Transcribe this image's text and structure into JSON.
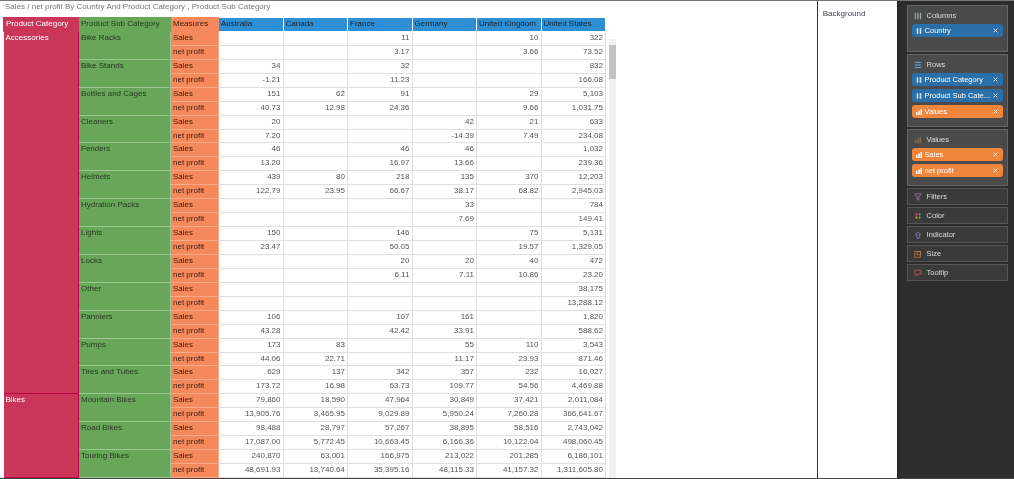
{
  "title": "Sales / net profit By Country And Product Category , Product Sub Category",
  "table": {
    "columns": [
      "Product Category",
      "Product Sub Category",
      "Measures",
      "Australia",
      "Canada",
      "France",
      "Germany",
      "United Kingdom",
      "United States"
    ],
    "groups": [
      {
        "category": "Accessories",
        "subcategories": [
          {
            "name": "Bike Racks",
            "rows": [
              {
                "measure": "Sales",
                "values": [
                  {
                    "empty": true
                  },
                  {
                    "empty": true
                  },
                  {
                    "value": "11"
                  },
                  {
                    "empty": true
                  },
                  {
                    "value": "10"
                  },
                  {
                    "value": "322"
                  }
                ]
              },
              {
                "measure": "net profit",
                "values": [
                  {
                    "empty": true
                  },
                  {
                    "empty": true
                  },
                  {
                    "value": "3.17"
                  },
                  {
                    "empty": true
                  },
                  {
                    "value": "3.66"
                  },
                  {
                    "value": "73.52"
                  }
                ]
              }
            ]
          },
          {
            "name": "Bike Stands",
            "rows": [
              {
                "measure": "Sales",
                "values": [
                  {
                    "value": "34"
                  },
                  {
                    "empty": true
                  },
                  {
                    "value": "32"
                  },
                  {
                    "empty": true
                  },
                  {
                    "empty": true
                  },
                  {
                    "value": "832"
                  }
                ]
              },
              {
                "measure": "net profit",
                "values": [
                  {
                    "value": "-1.21"
                  },
                  {
                    "empty": true
                  },
                  {
                    "value": "11.23"
                  },
                  {
                    "empty": true
                  },
                  {
                    "empty": true
                  },
                  {
                    "value": "166.08"
                  }
                ]
              }
            ]
          },
          {
            "name": "Bottles and Cages",
            "rows": [
              {
                "measure": "Sales",
                "values": [
                  {
                    "value": "151"
                  },
                  {
                    "value": "62"
                  },
                  {
                    "value": "91"
                  },
                  {
                    "empty": true
                  },
                  {
                    "value": "29"
                  },
                  {
                    "value": "5,103"
                  }
                ]
              },
              {
                "measure": "net profit",
                "values": [
                  {
                    "value": "40.73"
                  },
                  {
                    "value": "12.98"
                  },
                  {
                    "value": "24.36"
                  },
                  {
                    "empty": true
                  },
                  {
                    "value": "9.66"
                  },
                  {
                    "value": "1,031.75"
                  }
                ]
              }
            ]
          },
          {
            "name": "Cleaners",
            "rows": [
              {
                "measure": "Sales",
                "values": [
                  {
                    "value": "20"
                  },
                  {
                    "empty": true
                  },
                  {
                    "empty": true
                  },
                  {
                    "value": "42"
                  },
                  {
                    "value": "21"
                  },
                  {
                    "value": "633"
                  }
                ]
              },
              {
                "measure": "net profit",
                "values": [
                  {
                    "value": "7.20"
                  },
                  {
                    "empty": true
                  },
                  {
                    "empty": true
                  },
                  {
                    "value": "-14.39"
                  },
                  {
                    "value": "7.49"
                  },
                  {
                    "value": "234.08"
                  }
                ]
              }
            ]
          },
          {
            "name": "Fenders",
            "rows": [
              {
                "measure": "Sales",
                "values": [
                  {
                    "value": "46"
                  },
                  {
                    "empty": true
                  },
                  {
                    "value": "46"
                  },
                  {
                    "value": "46"
                  },
                  {
                    "empty": true
                  },
                  {
                    "value": "1,032"
                  }
                ]
              },
              {
                "measure": "net profit",
                "values": [
                  {
                    "value": "13.20"
                  },
                  {
                    "empty": true
                  },
                  {
                    "value": "16.97"
                  },
                  {
                    "value": "13.66"
                  },
                  {
                    "empty": true
                  },
                  {
                    "value": "239.36"
                  }
                ]
              }
            ]
          },
          {
            "name": "Helmets",
            "rows": [
              {
                "measure": "Sales",
                "values": [
                  {
                    "value": "439"
                  },
                  {
                    "value": "80"
                  },
                  {
                    "value": "218"
                  },
                  {
                    "value": "135"
                  },
                  {
                    "value": "370"
                  },
                  {
                    "value": "12,203"
                  }
                ]
              },
              {
                "measure": "net profit",
                "values": [
                  {
                    "value": "122.79"
                  },
                  {
                    "value": "23.95"
                  },
                  {
                    "value": "66.67"
                  },
                  {
                    "value": "38.17"
                  },
                  {
                    "value": "68.82"
                  },
                  {
                    "value": "2,945.03"
                  }
                ]
              }
            ]
          },
          {
            "name": "Hydration Packs",
            "rows": [
              {
                "measure": "Sales",
                "values": [
                  {
                    "empty": true
                  },
                  {
                    "empty": true
                  },
                  {
                    "empty": true
                  },
                  {
                    "value": "33"
                  },
                  {
                    "empty": true
                  },
                  {
                    "value": "784"
                  }
                ]
              },
              {
                "measure": "net profit",
                "values": [
                  {
                    "empty": true
                  },
                  {
                    "empty": true
                  },
                  {
                    "empty": true
                  },
                  {
                    "value": "7.69"
                  },
                  {
                    "empty": true
                  },
                  {
                    "value": "149.41"
                  }
                ]
              }
            ]
          },
          {
            "name": "Lights",
            "rows": [
              {
                "measure": "Sales",
                "values": [
                  {
                    "value": "150"
                  },
                  {
                    "empty": true
                  },
                  {
                    "value": "146"
                  },
                  {
                    "empty": true
                  },
                  {
                    "value": "75"
                  },
                  {
                    "value": "5,131"
                  }
                ]
              },
              {
                "measure": "net profit",
                "values": [
                  {
                    "value": "23.47"
                  },
                  {
                    "empty": true
                  },
                  {
                    "value": "50.05"
                  },
                  {
                    "empty": true
                  },
                  {
                    "value": "19.57"
                  },
                  {
                    "value": "1,329.05"
                  }
                ]
              }
            ]
          },
          {
            "name": "Locks",
            "rows": [
              {
                "measure": "Sales",
                "values": [
                  {
                    "empty": true
                  },
                  {
                    "empty": true
                  },
                  {
                    "value": "20"
                  },
                  {
                    "value": "20"
                  },
                  {
                    "value": "40"
                  },
                  {
                    "value": "472"
                  }
                ]
              },
              {
                "measure": "net profit",
                "values": [
                  {
                    "empty": true
                  },
                  {
                    "empty": true
                  },
                  {
                    "value": "6.11"
                  },
                  {
                    "value": "7.11"
                  },
                  {
                    "value": "10.86"
                  },
                  {
                    "value": "23.20"
                  }
                ]
              }
            ]
          },
          {
            "name": "Other",
            "rows": [
              {
                "measure": "Sales",
                "values": [
                  {
                    "empty": true
                  },
                  {
                    "empty": true
                  },
                  {
                    "empty": true
                  },
                  {
                    "empty": true
                  },
                  {
                    "empty": true
                  },
                  {
                    "value": "38,175"
                  }
                ]
              },
              {
                "measure": "net profit",
                "values": [
                  {
                    "empty": true
                  },
                  {
                    "empty": true
                  },
                  {
                    "empty": true
                  },
                  {
                    "empty": true
                  },
                  {
                    "empty": true
                  },
                  {
                    "value": "13,288.12"
                  }
                ]
              }
            ]
          },
          {
            "name": "Panniers",
            "rows": [
              {
                "measure": "Sales",
                "values": [
                  {
                    "value": "106"
                  },
                  {
                    "empty": true
                  },
                  {
                    "value": "107"
                  },
                  {
                    "value": "161"
                  },
                  {
                    "empty": true
                  },
                  {
                    "value": "1,820"
                  }
                ]
              },
              {
                "measure": "net profit",
                "values": [
                  {
                    "value": "43.28"
                  },
                  {
                    "empty": true
                  },
                  {
                    "value": "42.42"
                  },
                  {
                    "value": "33.91"
                  },
                  {
                    "empty": true
                  },
                  {
                    "value": "588.62"
                  }
                ]
              }
            ]
          },
          {
            "name": "Pumps",
            "rows": [
              {
                "measure": "Sales",
                "values": [
                  {
                    "value": "173"
                  },
                  {
                    "value": "83"
                  },
                  {
                    "empty": true
                  },
                  {
                    "value": "55"
                  },
                  {
                    "value": "110"
                  },
                  {
                    "value": "3,543"
                  }
                ]
              },
              {
                "measure": "net profit",
                "values": [
                  {
                    "value": "44.06"
                  },
                  {
                    "value": "22.71"
                  },
                  {
                    "empty": true
                  },
                  {
                    "value": "11.17"
                  },
                  {
                    "value": "23.93"
                  },
                  {
                    "value": "871.46"
                  }
                ]
              }
            ]
          },
          {
            "name": "Tires and Tubes",
            "rows": [
              {
                "measure": "Sales",
                "values": [
                  {
                    "value": "629"
                  },
                  {
                    "value": "137"
                  },
                  {
                    "value": "342"
                  },
                  {
                    "value": "357"
                  },
                  {
                    "value": "232"
                  },
                  {
                    "value": "16,027"
                  }
                ]
              },
              {
                "measure": "net profit",
                "values": [
                  {
                    "value": "173.72"
                  },
                  {
                    "value": "16.98"
                  },
                  {
                    "value": "63.73"
                  },
                  {
                    "value": "109.77"
                  },
                  {
                    "value": "54.56"
                  },
                  {
                    "value": "4,469.88"
                  }
                ]
              }
            ]
          }
        ]
      },
      {
        "category": "Bikes",
        "subcategories": [
          {
            "name": "Mountain Bikes",
            "rows": [
              {
                "measure": "Sales",
                "values": [
                  {
                    "value": "79,860"
                  },
                  {
                    "value": "18,590"
                  },
                  {
                    "value": "47,964"
                  },
                  {
                    "value": "30,849"
                  },
                  {
                    "value": "37,421"
                  },
                  {
                    "value": "2,011,084"
                  }
                ]
              },
              {
                "measure": "net profit",
                "values": [
                  {
                    "value": "13,905.76"
                  },
                  {
                    "value": "3,465.95"
                  },
                  {
                    "value": "9,029.89"
                  },
                  {
                    "value": "5,950.24"
                  },
                  {
                    "value": "7,260.28"
                  },
                  {
                    "value": "366,641.67"
                  }
                ]
              }
            ]
          },
          {
            "name": "Road Bikes",
            "rows": [
              {
                "measure": "Sales",
                "values": [
                  {
                    "value": "98,488"
                  },
                  {
                    "value": "28,797"
                  },
                  {
                    "value": "57,267"
                  },
                  {
                    "value": "38,895"
                  },
                  {
                    "value": "58,516"
                  },
                  {
                    "value": "2,743,042"
                  }
                ]
              },
              {
                "measure": "net profit",
                "values": [
                  {
                    "value": "17,087.00"
                  },
                  {
                    "value": "5,772.45"
                  },
                  {
                    "value": "10,663.45"
                  },
                  {
                    "value": "6,166.36"
                  },
                  {
                    "value": "10,122.04"
                  },
                  {
                    "value": "498,060.45"
                  }
                ]
              }
            ]
          },
          {
            "name": "Touring Bikes",
            "rows": [
              {
                "measure": "Sales",
                "values": [
                  {
                    "value": "240,870"
                  },
                  {
                    "value": "63,001"
                  },
                  {
                    "value": "166,975"
                  },
                  {
                    "value": "213,022"
                  },
                  {
                    "value": "201,285"
                  },
                  {
                    "value": "6,186,101"
                  }
                ]
              },
              {
                "measure": "net profit",
                "values": [
                  {
                    "value": "48,691.93"
                  },
                  {
                    "value": "13,740.64"
                  },
                  {
                    "value": "35,395.16"
                  },
                  {
                    "value": "48,115.33"
                  },
                  {
                    "value": "41,157.32"
                  },
                  {
                    "value": "1,311,605.80"
                  }
                ]
              }
            ]
          }
        ]
      }
    ]
  },
  "format_panel": {
    "label": "Background"
  },
  "fields_panel": {
    "sections": [
      {
        "kind": "columns",
        "label": "Columns",
        "expanded": true,
        "chips": [
          {
            "label": "Country",
            "kind": "dimension"
          }
        ]
      },
      {
        "kind": "rows",
        "label": "Rows",
        "expanded": true,
        "chips": [
          {
            "label": "Product Category",
            "kind": "dimension"
          },
          {
            "label": "Product Sub Cate...",
            "kind": "dimension"
          },
          {
            "label": "Values",
            "kind": "measure"
          }
        ]
      },
      {
        "kind": "values",
        "label": "Values",
        "expanded": true,
        "chips": [
          {
            "label": "Sales",
            "kind": "measure"
          },
          {
            "label": "net profit",
            "kind": "measure"
          }
        ]
      },
      {
        "kind": "filters",
        "label": "Filters",
        "expanded": false
      },
      {
        "kind": "color",
        "label": "Color",
        "expanded": false
      },
      {
        "kind": "indicator",
        "label": "Indicator",
        "expanded": false
      },
      {
        "kind": "size",
        "label": "Size",
        "expanded": false
      },
      {
        "kind": "tooltip",
        "label": "Tooltip",
        "expanded": false
      }
    ]
  }
}
